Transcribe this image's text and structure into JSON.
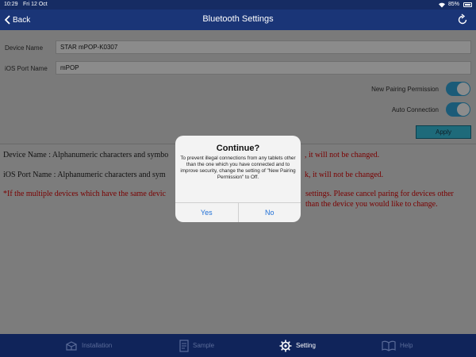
{
  "status_bar": {
    "time": "10:29",
    "date": "Fri 12 Oct",
    "battery": "85%"
  },
  "nav": {
    "back_label": "Back",
    "title": "Bluetooth Settings"
  },
  "form": {
    "device_name_label": "Device Name",
    "device_name_value": "STAR mPOP-K0307",
    "port_name_label": "iOS Port Name",
    "port_name_value": "mPOP",
    "pairing_label": "New Pairing Permission",
    "pairing_on": true,
    "auto_label": "Auto Connection",
    "auto_on": true,
    "apply_label": "Apply",
    "toggle_color": "#1b5b78"
  },
  "info": {
    "device_prefix": "Device Name : Alphanumeric characters and symbo",
    "device_suffix": ", it will not be changed.",
    "port_prefix": "iOS Port Name : Alphanumeric characters and sym",
    "port_suffix": "k, it will not be changed.",
    "note": "*If the multiple devices which have the same devic",
    "note_suffix": "settings. Please cancel paring for devices other than the device you would like to change."
  },
  "dialog": {
    "title": "Continue?",
    "message": "To prevent illegal connections from any tablets other than the one which you have connected and to improve security, change the setting of \"New Pairing Permission\" to Off.",
    "yes_label": "Yes",
    "no_label": "No",
    "button_color": "#1f6fd6"
  },
  "tabs": [
    {
      "label": "Installation",
      "icon": "installation-icon",
      "active": false
    },
    {
      "label": "Sample",
      "icon": "sample-icon",
      "active": false
    },
    {
      "label": "Setting",
      "icon": "gear-icon",
      "active": true
    },
    {
      "label": "Help",
      "icon": "book-icon",
      "active": false
    }
  ]
}
